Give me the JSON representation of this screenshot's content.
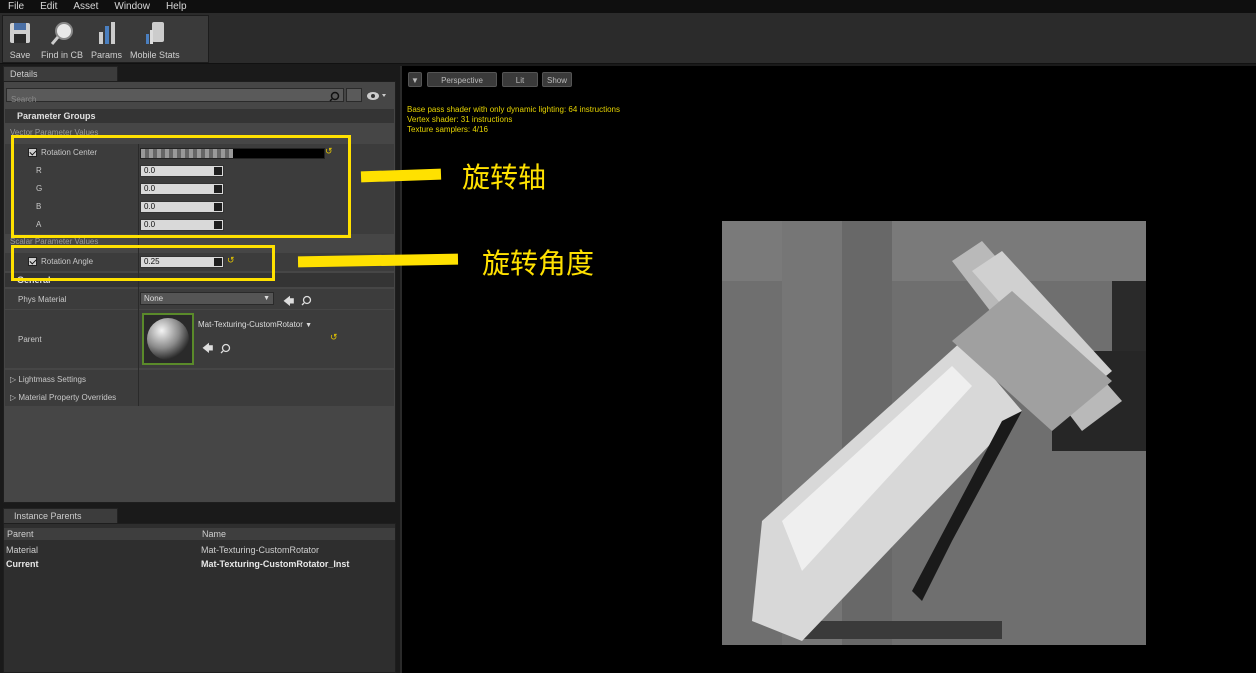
{
  "menubar": [
    "File",
    "Edit",
    "Asset",
    "Window",
    "Help"
  ],
  "toolbar": {
    "buttons": [
      "Save",
      "Find in CB",
      "Params",
      "Mobile Stats"
    ]
  },
  "details": {
    "tab_label": "Details",
    "search_placeholder": "Search",
    "parameter_groups": "Parameter Groups",
    "vector_param_header": "Vector Parameter Values",
    "rotation_center": {
      "label": "Rotation Center",
      "channels": [
        {
          "name": "R",
          "value": "0.0"
        },
        {
          "name": "G",
          "value": "0.0"
        },
        {
          "name": "B",
          "value": "0.0"
        },
        {
          "name": "A",
          "value": "0.0"
        }
      ]
    },
    "scalar_param_header": "Scalar Parameter Values",
    "rotation_angle": {
      "label": "Rotation Angle",
      "value": "0.25"
    },
    "general_header": "General",
    "phys_material": {
      "label": "Phys Material",
      "value": "None"
    },
    "parent": {
      "label": "Parent",
      "value": "Mat-Texturing-CustomRotator"
    },
    "lightmass_settings": "Lightmass Settings",
    "material_property_overrides": "Material Property Overrides"
  },
  "instance_parents": {
    "tab_label": "Instance Parents",
    "columns": [
      "Parent",
      "Name"
    ],
    "rows": [
      {
        "parent": "Material",
        "name": "Mat-Texturing-CustomRotator"
      },
      {
        "parent": "Current",
        "name": "Mat-Texturing-CustomRotator_Inst"
      }
    ]
  },
  "viewport": {
    "buttons": [
      "Perspective",
      "Lit",
      "Show"
    ],
    "stats": [
      "Base pass shader with only dynamic lighting: 64 instructions",
      "Vertex shader: 31 instructions",
      "Texture samplers: 4/16"
    ]
  },
  "annotations": {
    "rotation_axis": "旋转轴",
    "rotation_angle": "旋转角度"
  },
  "colors": {
    "annotation": "#ffe100",
    "stats_text": "#e6d400"
  }
}
